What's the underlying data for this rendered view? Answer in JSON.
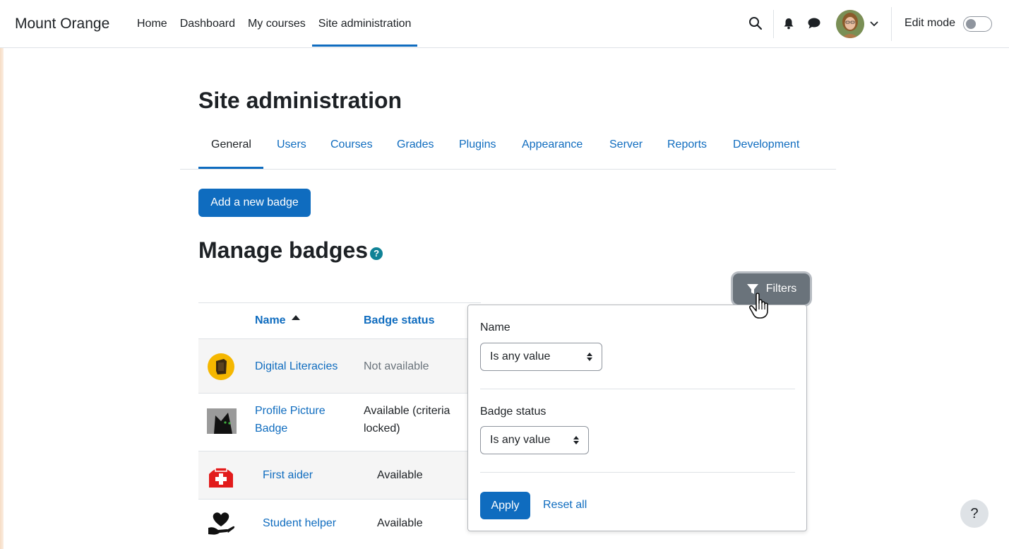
{
  "navbar": {
    "brand": "Mount Orange",
    "links": [
      {
        "label": "Home"
      },
      {
        "label": "Dashboard"
      },
      {
        "label": "My courses"
      },
      {
        "label": "Site administration",
        "active": true
      }
    ],
    "edit_mode_label": "Edit mode",
    "edit_mode_on": false,
    "icons": [
      "search-icon",
      "bell-icon",
      "chat-icon",
      "avatar",
      "chevron-down-icon"
    ]
  },
  "page": {
    "title": "Site administration",
    "tabs": [
      {
        "label": "General",
        "active": true
      },
      {
        "label": "Users"
      },
      {
        "label": "Courses"
      },
      {
        "label": "Grades"
      },
      {
        "label": "Plugins"
      },
      {
        "label": "Appearance"
      },
      {
        "label": "Server"
      },
      {
        "label": "Reports"
      },
      {
        "label": "Development"
      }
    ],
    "add_badge_label": "Add a new badge",
    "section_title": "Manage badges",
    "help_icon": "?"
  },
  "table": {
    "columns": {
      "name": "Name",
      "status": "Badge status"
    },
    "sort": {
      "column": "name",
      "direction": "asc"
    },
    "rows": [
      {
        "name": "Digital Literacies",
        "status": "Not available",
        "icon": "digital-literacies-badge-icon"
      },
      {
        "name": "Profile Picture Badge",
        "status": "Available (criteria locked)",
        "icon": "profile-picture-badge-icon"
      },
      {
        "name": "First aider",
        "status": "Available",
        "icon": "first-aider-badge-icon"
      },
      {
        "name": "Student helper",
        "status": "Available",
        "icon": "student-helper-badge-icon"
      }
    ]
  },
  "filters": {
    "button_label": "Filters",
    "fields": [
      {
        "label": "Name",
        "value": "Is any value"
      },
      {
        "label": "Badge status",
        "value": "Is any value"
      }
    ],
    "apply_label": "Apply",
    "reset_label": "Reset all"
  },
  "help_fab": "?",
  "colors": {
    "primary": "#0f6cbf",
    "text": "#1d2125",
    "muted": "#6a737b",
    "filters_button": "#6a737b",
    "help_dot": "#0f8296"
  }
}
